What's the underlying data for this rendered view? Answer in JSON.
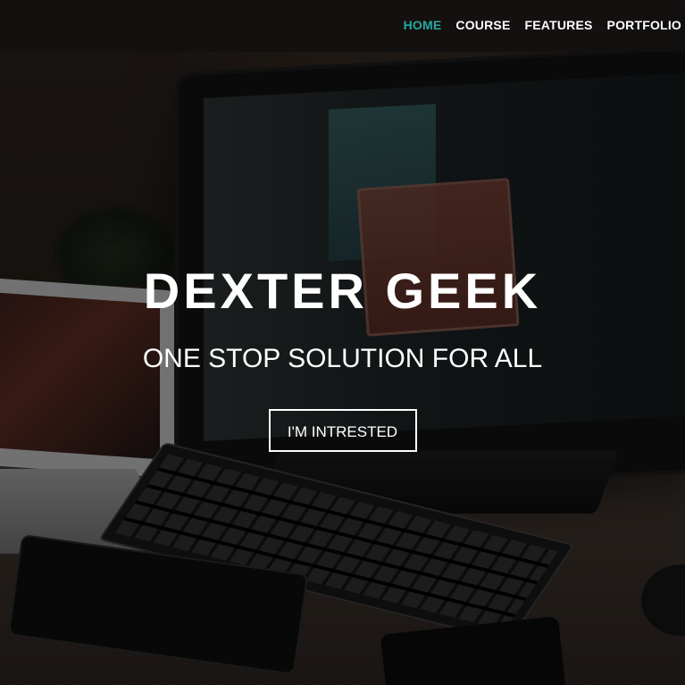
{
  "nav": {
    "items": [
      {
        "label": "HOME",
        "active": true
      },
      {
        "label": "COURSE",
        "active": false
      },
      {
        "label": "FEATURES",
        "active": false
      },
      {
        "label": "PORTFOLIO",
        "active": false
      }
    ],
    "active_color": "#25a8a0"
  },
  "hero": {
    "title": "DEXTER GEEK",
    "subtitle": "ONE STOP SOLUTION FOR ALL",
    "cta_label": "I'M INTRESTED"
  }
}
